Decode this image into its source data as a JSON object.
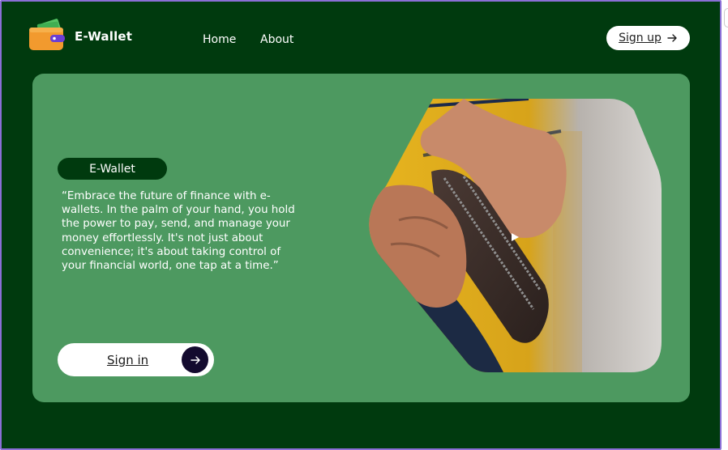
{
  "header": {
    "logo_text": "E-Wallet",
    "nav": [
      {
        "label": "Home"
      },
      {
        "label": "About"
      }
    ],
    "signup_label": "Sign up"
  },
  "hero": {
    "badge": "E-Wallet",
    "quote": "“Embrace the future of finance with e-wallets. In the palm of your hand, you hold the power to pay, send, and manage your money effortlessly. It's not just about convenience; it's about taking control of your financial world, one tap at a time.”",
    "signin_label": "Sign in"
  },
  "icons": {
    "logo": "wallet-money-icon",
    "signup": "arrow-right-icon",
    "signin": "arrow-right-icon",
    "media": "play-icon"
  },
  "colors": {
    "page_background": "#003a0e",
    "card_background": "#4d9960",
    "badge_background": "#003a0e",
    "signin_circle": "#130a2e",
    "logo_wallet": "#f29a2e",
    "logo_clasp": "#6b3fd4",
    "logo_cash": "#55c465"
  }
}
